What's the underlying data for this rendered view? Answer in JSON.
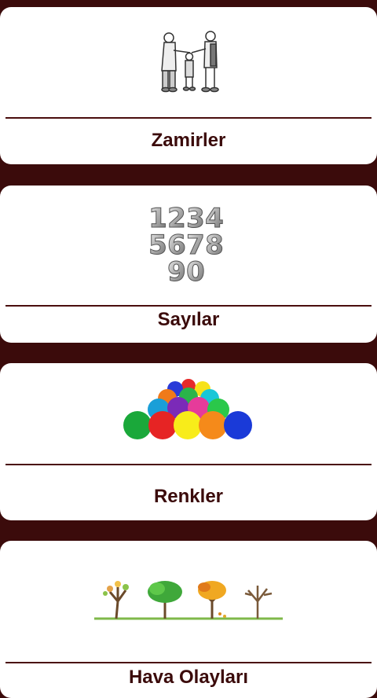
{
  "categories": [
    {
      "label": "Zamirler",
      "icon": "people-pointing-icon"
    },
    {
      "label": "Sayılar",
      "icon": "balloon-numbers-icon"
    },
    {
      "label": "Renkler",
      "icon": "colored-balls-icon"
    },
    {
      "label": "Hava Olayları",
      "icon": "four-seasons-trees-icon"
    }
  ],
  "colors": {
    "background": "#3b0b0b",
    "card": "#ffffff",
    "accent": "#4a0d0d"
  }
}
